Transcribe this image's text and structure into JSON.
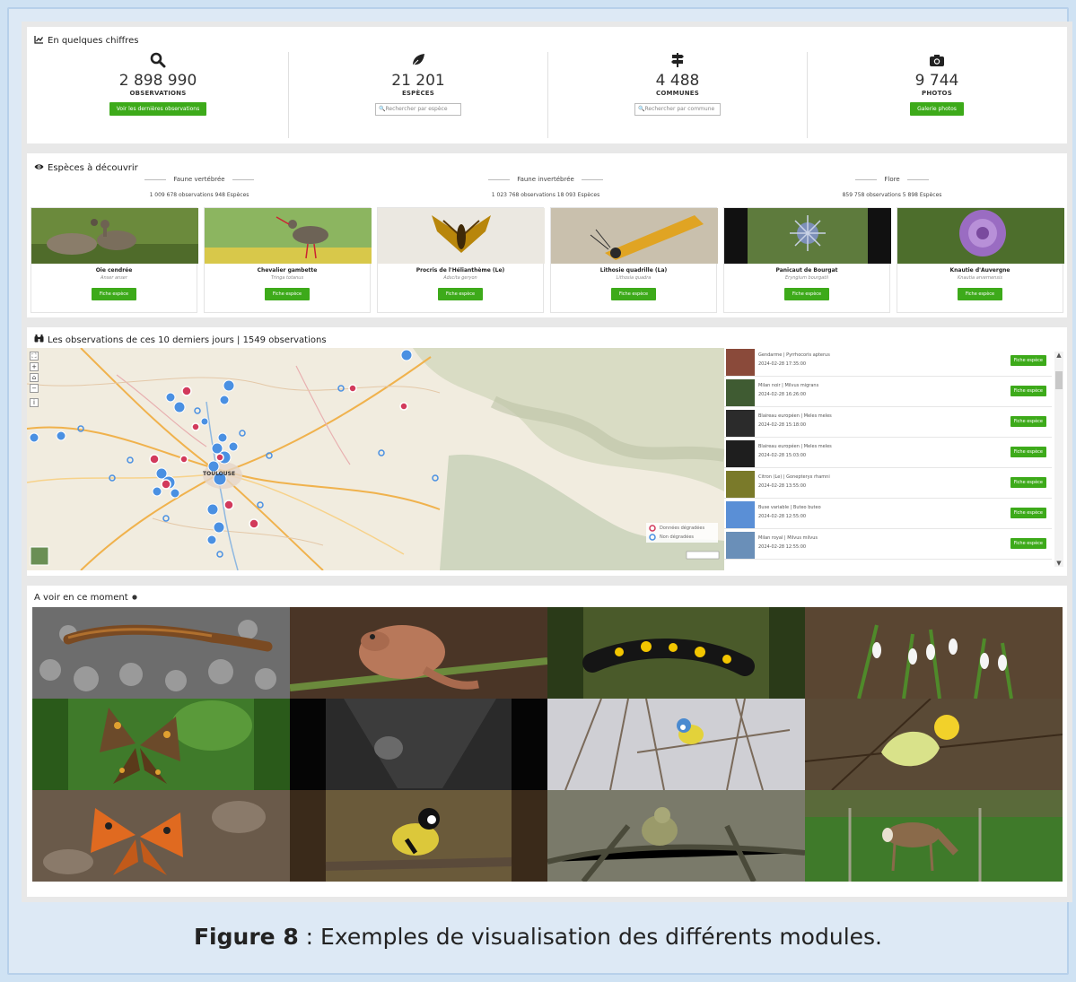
{
  "stats_panel": {
    "title": "En quelques chiffres",
    "items": [
      {
        "icon": "search-icon",
        "number": "2 898 990",
        "label": "OBSERVATIONS",
        "button": "Voir les dernières observations"
      },
      {
        "icon": "leaf-icon",
        "number": "21 201",
        "label": "ESPÈCES",
        "placeholder": "Rechercher par espèce"
      },
      {
        "icon": "signpost-icon",
        "number": "4 488",
        "label": "COMMUNES",
        "placeholder": "Rechercher par commune"
      },
      {
        "icon": "camera-icon",
        "number": "9 744",
        "label": "PHOTOS",
        "button": "Galerie photos"
      }
    ]
  },
  "species_panel": {
    "title": "Espèces à découvrir",
    "categories": [
      {
        "name": "Faune vertébrée",
        "stats": "1 009 678 observations 948 Espèces"
      },
      {
        "name": "Faune invertébrée",
        "stats": "1 023 768 observations 18 093 Espèces"
      },
      {
        "name": "Flore",
        "stats": "859 758 observations 5 898 Espèces"
      }
    ],
    "cards": [
      {
        "name": "Oie cendrée",
        "latin": "Anser anser",
        "button": "Fiche espèce",
        "color": "#6b8a3c"
      },
      {
        "name": "Chevalier gambette",
        "latin": "Tringa totanus",
        "button": "Fiche espèce",
        "color": "#8cb560"
      },
      {
        "name": "Procris de l'Hélianthème (Le)",
        "latin": "Adscita geryon",
        "button": "Fiche espèce",
        "color": "#e9e6df"
      },
      {
        "name": "Lithosie quadrille (La)",
        "latin": "Lithosia quadra",
        "button": "Fiche espèce",
        "color": "#c9c0ad"
      },
      {
        "name": "Panicaut de Bourgat",
        "latin": "Eryngium bourgatii",
        "button": "Fiche espèce",
        "color": "#5e7b3d"
      },
      {
        "name": "Knautie d'Auvergne",
        "latin": "Knautia arvernensis",
        "button": "Fiche espèce",
        "color": "#8a5aa8"
      }
    ]
  },
  "map_panel": {
    "title": "Les observations de ces 10 derniers jours | 1549 observations",
    "city_label": "TOULOUSE",
    "legend": [
      "Données dégradées",
      "Non dégradées"
    ],
    "observations": [
      {
        "name": "Gendarme | Pyrrhocoris apterus",
        "date": "2024-02-28 17:35:00",
        "button": "Fiche espèce"
      },
      {
        "name": "Milan noir | Milvus migrans",
        "date": "2024-02-28 16:26:00",
        "button": "Fiche espèce"
      },
      {
        "name": "Blaireau européen | Meles meles",
        "date": "2024-02-28 15:18:00",
        "button": "Fiche espèce"
      },
      {
        "name": "Blaireau européen | Meles meles",
        "date": "2024-02-28 15:03:00",
        "button": "Fiche espèce"
      },
      {
        "name": "Citron (Le) | Gonepteryx rhamni",
        "date": "2024-02-28 13:55:00",
        "button": "Fiche espèce"
      },
      {
        "name": "Buse variable | Buteo buteo",
        "date": "2024-02-28 12:55:00",
        "button": "Fiche espèce"
      },
      {
        "name": "Milan royal | Milvus milvus",
        "date": "2024-02-28 12:55:00",
        "button": "Fiche espèce"
      }
    ]
  },
  "gallery_panel": {
    "title": "A voir en ce moment"
  },
  "caption": {
    "bold": "Figure 8",
    "text": " : Exemples de visualisation des différents modules."
  }
}
